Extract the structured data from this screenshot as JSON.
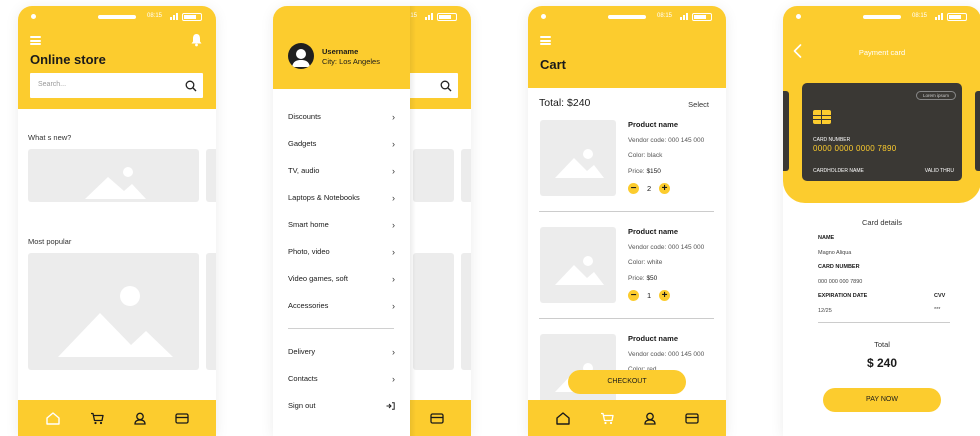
{
  "colors": {
    "accent": "#fccc2e",
    "placeholder": "#ececec",
    "card": "#3a3834"
  },
  "statusbar": {
    "time": "08:15"
  },
  "store": {
    "title": "Online store",
    "search_placeholder": "Search...",
    "whats_new": "What s new?",
    "most_popular": "Most popular"
  },
  "menu": {
    "username": "Username",
    "city": "City: Los Angeles",
    "items": [
      "Discounts",
      "Gadgets",
      "TV, audio",
      "Laptops & Notebooks",
      "Smart home",
      "Photo, video",
      "Video games, soft",
      "Accessories"
    ],
    "extras": [
      "Delivery",
      "Contacts",
      "Sign out"
    ]
  },
  "cart": {
    "title": "Cart",
    "total": "Total: $240",
    "select": "Select",
    "products": [
      {
        "name": "Product name",
        "vendor": "Vendor code: 000 145 000",
        "color": "Color: black",
        "price_label": "Price:",
        "price": "$150",
        "qty": "2"
      },
      {
        "name": "Product name",
        "vendor": "Vendor code: 000 145 000",
        "color": "Color: white",
        "price_label": "Price:",
        "price": "$50",
        "qty": "1"
      },
      {
        "name": "Product name",
        "vendor": "Vendor code: 000 145 000",
        "color": "Color: red",
        "price_label": "",
        "price": "",
        "qty": ""
      }
    ],
    "checkout": "CHECKOUT"
  },
  "payment": {
    "title": "Payment card",
    "card_badge": "Lorem ipsum",
    "card_number_label": "CARD NUMBER",
    "card_number": "0000  0000  0000  7890",
    "cardholder_label": "CARDHOLDER NAME",
    "valid_label": "VALID THRU",
    "details_title": "Card details",
    "name_label": "NAME",
    "name_value": "Magno Aliqua",
    "number_label": "CARD NUMBER",
    "number_value": "000 000 000 7890",
    "exp_label": "EXPIRATION DATE",
    "exp_value": "12/25",
    "cvv_label": "CVV",
    "cvv_value": "***",
    "total_label": "Total",
    "total_value": "$ 240",
    "pay_button": "PAY NOW"
  }
}
